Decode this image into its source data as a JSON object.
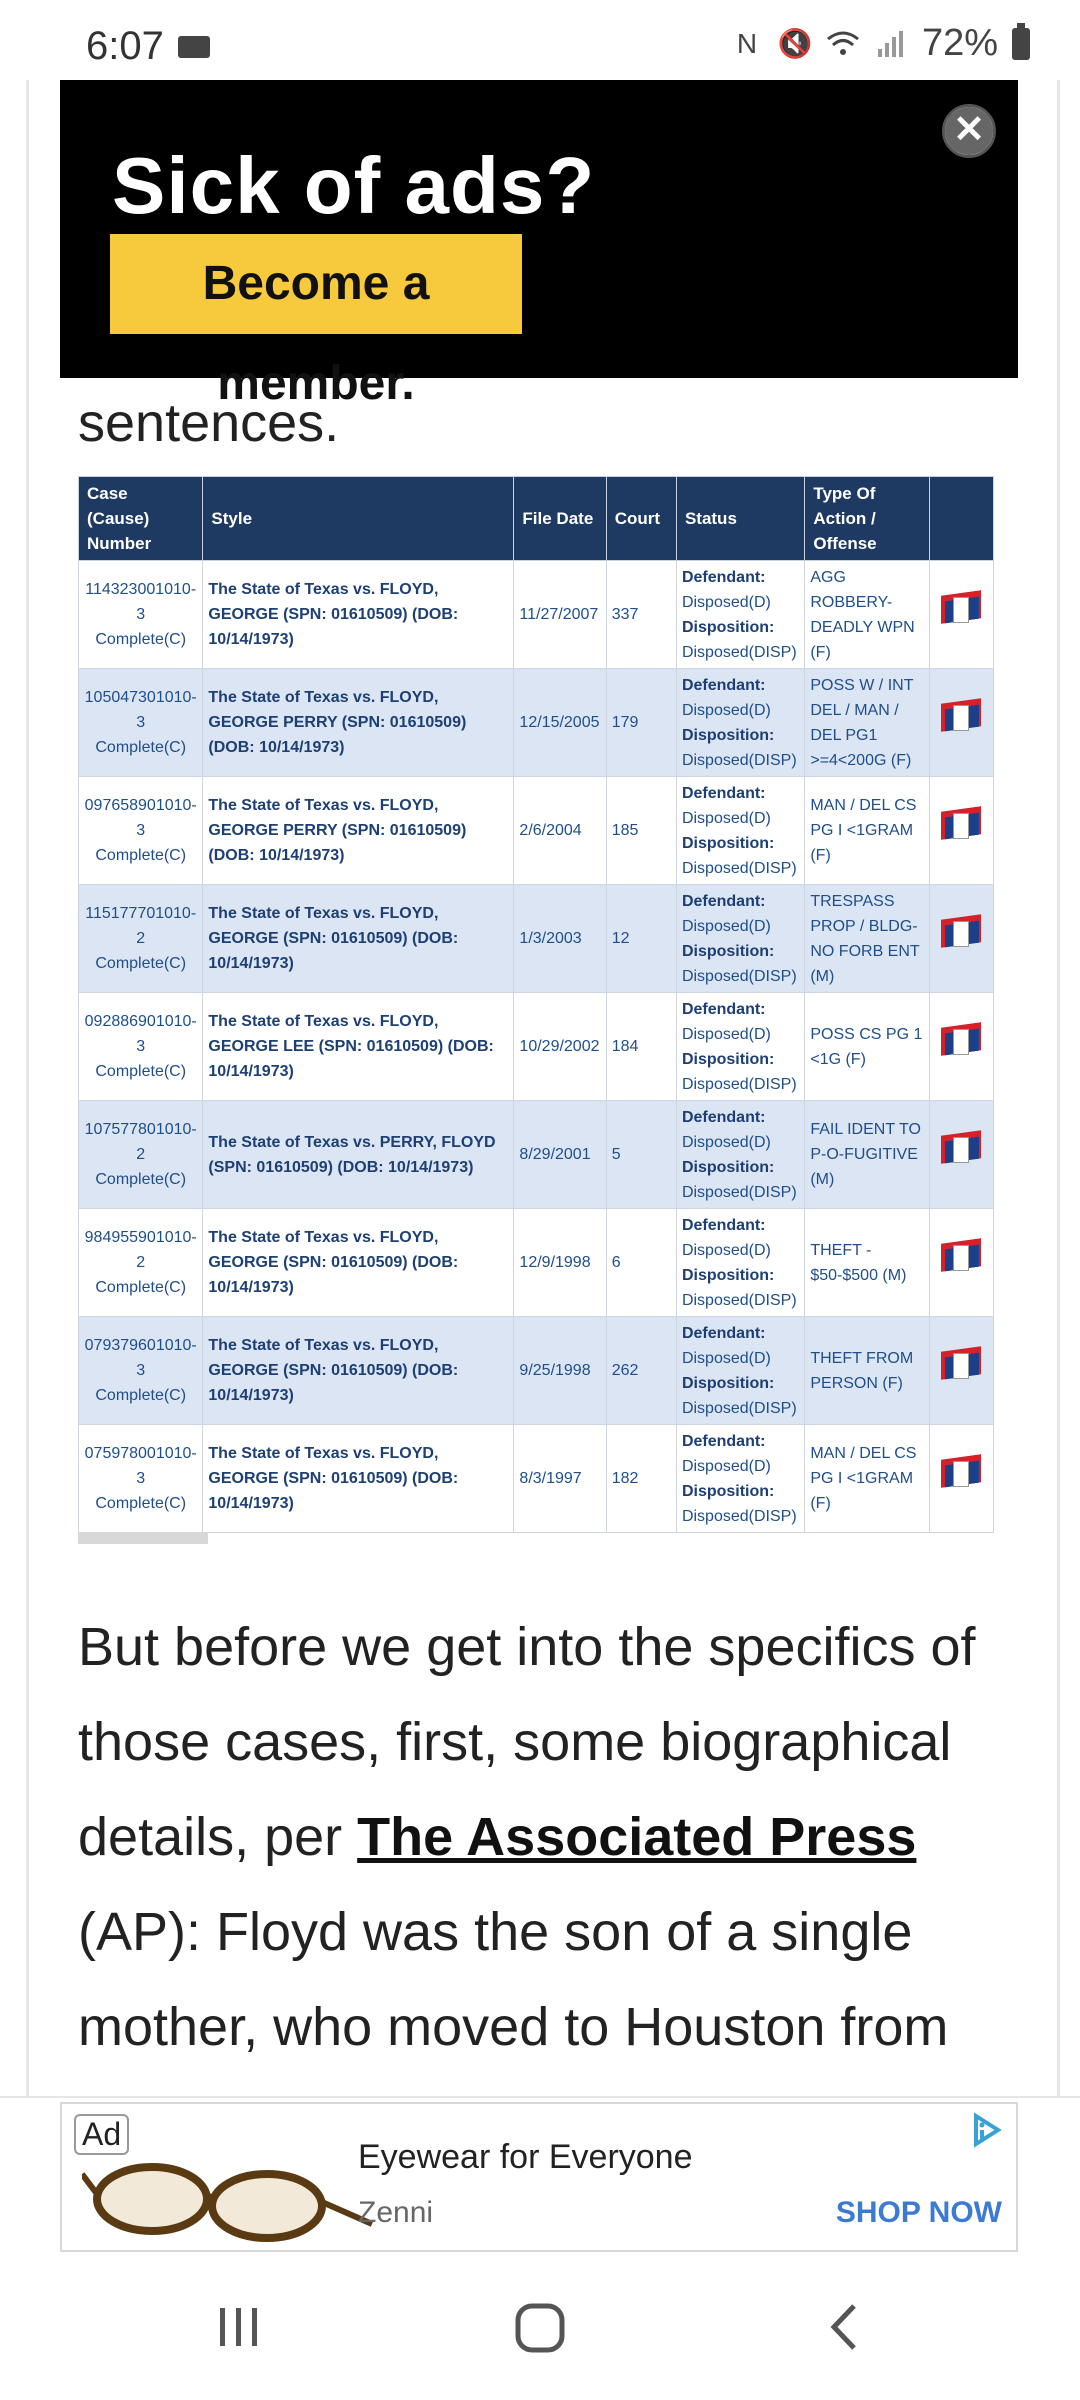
{
  "status_bar": {
    "time": "6:07",
    "battery": "72%"
  },
  "top_ad": {
    "title": "Sick of ads?",
    "button": "Become a member.",
    "close_glyph": "✕"
  },
  "lead_text": "sentences.",
  "table": {
    "headers": [
      "Case (Cause) Number",
      "Style",
      "File Date",
      "Court",
      "Status",
      "Type Of Action / Offense",
      ""
    ],
    "rows": [
      {
        "cause": "114323001010-3",
        "cause_status": "Complete(C)",
        "style": "The State of Texas vs. FLOYD, GEORGE (SPN: 01610509) (DOB: 10/14/1973)",
        "date": "11/27/2007",
        "court": "337",
        "defendant": "Disposed(D)",
        "disposition": "Disposed(DISP)",
        "offense": "AGG ROBBERY-DEADLY WPN (F)"
      },
      {
        "cause": "105047301010-3",
        "cause_status": "Complete(C)",
        "style": "The State of Texas vs. FLOYD, GEORGE PERRY (SPN: 01610509) (DOB: 10/14/1973)",
        "date": "12/15/2005",
        "court": "179",
        "defendant": "Disposed(D)",
        "disposition": "Disposed(DISP)",
        "offense": "POSS W / INT DEL / MAN / DEL PG1 >=4<200G (F)"
      },
      {
        "cause": "097658901010-3",
        "cause_status": "Complete(C)",
        "style": "The State of Texas vs. FLOYD, GEORGE PERRY (SPN: 01610509) (DOB: 10/14/1973)",
        "date": "2/6/2004",
        "court": "185",
        "defendant": "Disposed(D)",
        "disposition": "Disposed(DISP)",
        "offense": "MAN / DEL CS PG I <1GRAM (F)"
      },
      {
        "cause": "115177701010-2",
        "cause_status": "Complete(C)",
        "style": "The State of Texas vs. FLOYD, GEORGE (SPN: 01610509) (DOB: 10/14/1973)",
        "date": "1/3/2003",
        "court": "12",
        "defendant": "Disposed(D)",
        "disposition": "Disposed(DISP)",
        "offense": "TRESPASS PROP / BLDG-NO FORB ENT (M)"
      },
      {
        "cause": "092886901010-3",
        "cause_status": "Complete(C)",
        "style": "The State of Texas vs. FLOYD, GEORGE LEE (SPN: 01610509) (DOB: 10/14/1973)",
        "date": "10/29/2002",
        "court": "184",
        "defendant": "Disposed(D)",
        "disposition": "Disposed(DISP)",
        "offense": "POSS CS PG 1 <1G (F)"
      },
      {
        "cause": "107577801010-2",
        "cause_status": "Complete(C)",
        "style": "The State of Texas vs. PERRY, FLOYD (SPN: 01610509) (DOB: 10/14/1973)",
        "date": "8/29/2001",
        "court": "5",
        "defendant": "Disposed(D)",
        "disposition": "Disposed(DISP)",
        "offense": "FAIL IDENT TO P-O-FUGITIVE (M)"
      },
      {
        "cause": "984955901010-2",
        "cause_status": "Complete(C)",
        "style": "The State of Texas vs. FLOYD, GEORGE (SPN: 01610509) (DOB: 10/14/1973)",
        "date": "12/9/1998",
        "court": "6",
        "defendant": "Disposed(D)",
        "disposition": "Disposed(DISP)",
        "offense": "THEFT - $50-$500 (M)"
      },
      {
        "cause": "079379601010-3",
        "cause_status": "Complete(C)",
        "style": "The State of Texas vs. FLOYD, GEORGE (SPN: 01610509) (DOB: 10/14/1973)",
        "date": "9/25/1998",
        "court": "262",
        "defendant": "Disposed(D)",
        "disposition": "Disposed(DISP)",
        "offense": "THEFT FROM PERSON (F)"
      },
      {
        "cause": "075978001010-3",
        "cause_status": "Complete(C)",
        "style": "The State of Texas vs. FLOYD, GEORGE (SPN: 01610509) (DOB: 10/14/1973)",
        "date": "8/3/1997",
        "court": "182",
        "defendant": "Disposed(D)",
        "disposition": "Disposed(DISP)",
        "offense": "MAN / DEL CS PG I <1GRAM (F)"
      }
    ],
    "defendant_label": "Defendant:",
    "disposition_label": "Disposition:"
  },
  "body": {
    "before_link": "But before we get into the specifics of those cases, first, some biographical details, per ",
    "link": "The Associated Press",
    "after_link": " (AP): Floyd was the son of a single mother, who moved to Houston from"
  },
  "bottom_ad": {
    "label": "Ad",
    "title": "Eyewear for Everyone",
    "brand": "Zenni",
    "cta": "SHOP NOW"
  },
  "colors": {
    "table_header": "#1e3a63",
    "row_alt": "#dbe5f3",
    "link_text": "#1f4e8a",
    "ad_button": "#f7c93c",
    "cta": "#3b7bd4"
  }
}
